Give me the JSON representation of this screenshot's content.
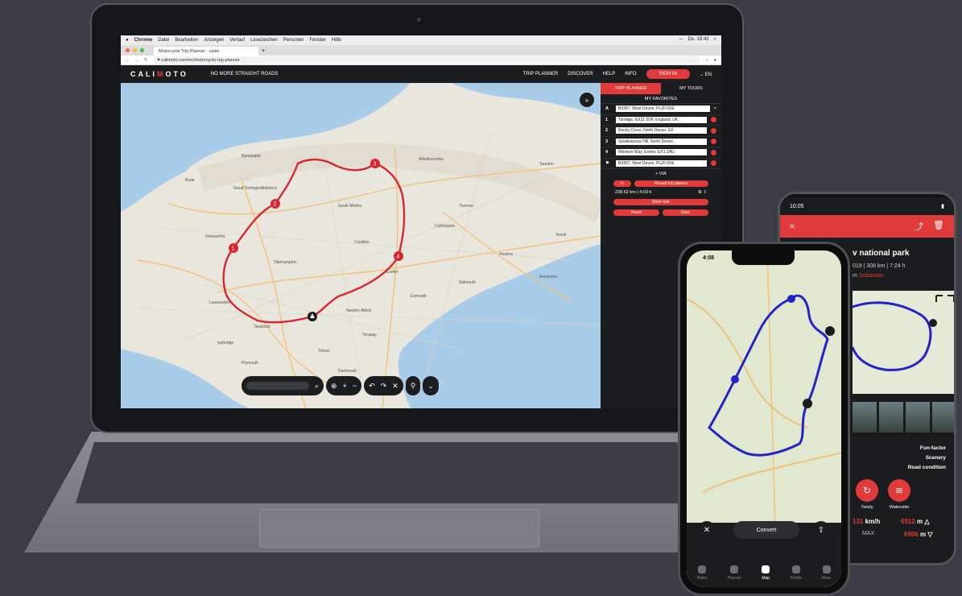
{
  "mac_menubar": {
    "items": [
      "Chrome",
      "Datei",
      "Bearbeiten",
      "Anzeigen",
      "Verlauf",
      "Lesezeichen",
      "Personen",
      "Fenster",
      "Hilfe"
    ],
    "clock": "Do. 19:42"
  },
  "browser": {
    "tab_title": "Motorcycle Trip Planner · calim",
    "url": "calimoto.com/en/motorcycle-trip-planner"
  },
  "app": {
    "logo_left": "CALI",
    "logo_mid": "M",
    "logo_right": "OTO",
    "slogan": "NO MORE STRAIGHT ROADS",
    "nav": [
      "TRIP PLANNER",
      "DISCOVER",
      "HELP",
      "INFO"
    ],
    "signin": "SIGN IN",
    "language": "EN"
  },
  "sidebar": {
    "tab_planner": "TRIP PLANNER",
    "tab_tours": "MY TOURS",
    "favorites": "MY FAVORITES",
    "waypoints": [
      {
        "label": "A",
        "text": "B3357, West Devon, PL20 6SE"
      },
      {
        "label": "1",
        "text": "Torridge, EX21 5DF, England, UK"
      },
      {
        "label": "2",
        "text": "Rocky Cross, North Devon, EX"
      },
      {
        "label": "3",
        "text": "Swallowsrow Hill, North Devon"
      },
      {
        "label": "4",
        "text": "Western Way, Exeter, EX1 2AU"
      },
      {
        "label": "⚑",
        "text": "B3357, West Devon, PL20 6SE"
      }
    ],
    "via": "+ VIA",
    "roundtrip": "Round trip planner",
    "distance": "238.62 km | 4:03 h",
    "store_tour": "Store tour",
    "reset": "Reset",
    "save": "Save"
  },
  "map": {
    "labels": [
      {
        "text": "Barnstaple"
      },
      {
        "text": "Bideford"
      },
      {
        "text": "South Molton"
      },
      {
        "text": "Tiverton"
      },
      {
        "text": "Cullompton"
      },
      {
        "text": "Crediton"
      },
      {
        "text": "Exeter"
      },
      {
        "text": "Okehampton"
      },
      {
        "text": "Launceston"
      },
      {
        "text": "Tavistock"
      },
      {
        "text": "Plymouth"
      },
      {
        "text": "Torquay"
      },
      {
        "text": "Newton Abbot"
      },
      {
        "text": "Exmouth"
      },
      {
        "text": "Taunton"
      },
      {
        "text": "Wiveliscombe"
      },
      {
        "text": "Holsworthy"
      },
      {
        "text": "Great Torrington"
      },
      {
        "text": "Honiton"
      },
      {
        "text": "Yeovil"
      },
      {
        "text": "Totnes"
      },
      {
        "text": "Ivybridge"
      },
      {
        "text": "Dartmouth"
      },
      {
        "text": "Bude"
      },
      {
        "text": "Axminster"
      },
      {
        "text": "Sidmouth"
      }
    ]
  },
  "phone1": {
    "time": "4:08",
    "convert": "Convert",
    "nav": [
      "Rides",
      "Planner",
      "Map",
      "Profile",
      "More"
    ]
  },
  "phone2": {
    "time": "10:05",
    "title": "v national park",
    "meta": "019 | 308 km | 7:24 h",
    "author_prefix": "m ",
    "author": "Sebastian",
    "ratings": [
      "Fun-factor",
      "Scenery",
      "Road condition"
    ],
    "badges": [
      "Twisty",
      "Waterside"
    ],
    "speed_value": "131",
    "speed_unit": " km/h",
    "max": "MAX",
    "alt_up_value": "6912",
    "alt_up_unit": " m △",
    "alt_down_value": "6906",
    "alt_down_unit": " m ▽"
  }
}
